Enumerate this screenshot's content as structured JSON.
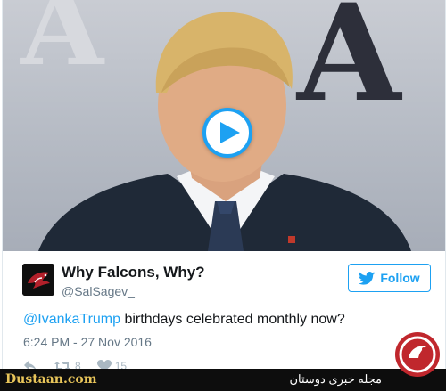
{
  "media": {
    "bg_letter": "A",
    "play_label": "Play video"
  },
  "author": {
    "name": "Why Falcons, Why?",
    "handle": "@SalSagev_"
  },
  "follow": {
    "label": "Follow"
  },
  "tweet": {
    "mention": "@IvankaTrump",
    "body": " birthdays celebrated monthly now?",
    "timestamp": "6:24 PM - 27 Nov 2016"
  },
  "actions": {
    "retweets": "8",
    "likes": "15"
  },
  "watermark": {
    "site": "Dustaan.com",
    "tagline": "مجله خبری دوستان"
  },
  "colors": {
    "accent": "#1da1f2",
    "text": "#14171a",
    "muted": "#657786",
    "watermark_gold": "#e8c55a"
  }
}
